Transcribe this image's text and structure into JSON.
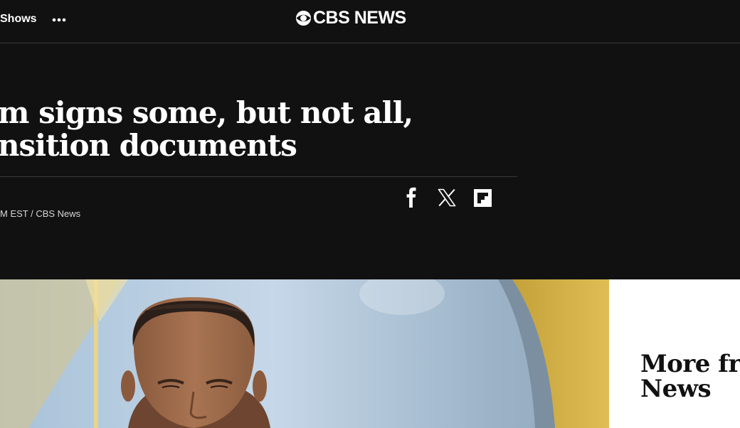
{
  "header": {
    "nav_shows": "Shows",
    "more_icon": "more-dots-icon",
    "logo_text": "CBS NEWS",
    "logo_icon": "cbs-eye-icon"
  },
  "article": {
    "headline_line1": "m signs some, but not all,",
    "headline_line2": "nsition documents",
    "byline": "M EST / CBS News"
  },
  "share": {
    "facebook_icon": "facebook-icon",
    "x_icon": "x-icon",
    "flipboard_icon": "flipboard-icon"
  },
  "video": {
    "content": "news-anchor-video-thumbnail"
  },
  "sidebar": {
    "title_line1": "More fro",
    "title_line2": "News"
  },
  "colors": {
    "background": "#111111",
    "text": "#ffffff",
    "divider": "#3a3a3a",
    "sidebar_background": "#ffffff"
  }
}
